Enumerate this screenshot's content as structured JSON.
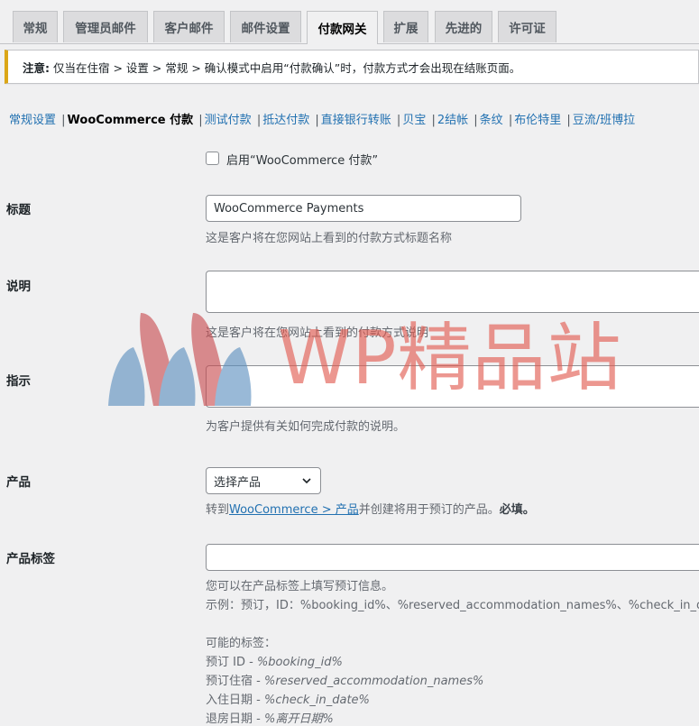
{
  "tabs": [
    {
      "label": "常规",
      "active": false
    },
    {
      "label": "管理员邮件",
      "active": false
    },
    {
      "label": "客户邮件",
      "active": false
    },
    {
      "label": "邮件设置",
      "active": false
    },
    {
      "label": "付款网关",
      "active": true
    },
    {
      "label": "扩展",
      "active": false
    },
    {
      "label": "先进的",
      "active": false
    },
    {
      "label": "许可证",
      "active": false
    }
  ],
  "notice": {
    "strong": "注意:",
    "text": "仅当在住宿 > 设置 > 常规 > 确认模式中启用“付款确认”时，付款方式才会出现在结账页面。"
  },
  "subnav": {
    "items": [
      "常规设置",
      "WooCommerce 付款",
      "测试付款",
      "抵达付款",
      "直接银行转账",
      "贝宝",
      "2结帐",
      "条纹",
      "布伦特里",
      "豆流/班博拉"
    ],
    "current_index": 1
  },
  "enable": {
    "label": "启用“WooCommerce 付款”",
    "checked": false
  },
  "title_field": {
    "label": "标题",
    "value": "WooCommerce Payments",
    "desc": "这是客户将在您网站上看到的付款方式标题名称"
  },
  "description_field": {
    "label": "说明",
    "value": "",
    "desc": "这是客户将在您网站上看到的付款方式说明"
  },
  "instructions_field": {
    "label": "指示",
    "value": "",
    "desc": "为客户提供有关如何完成付款的说明。"
  },
  "product_field": {
    "label": "产品",
    "selected": "选择产品",
    "desc_prefix": "转到",
    "desc_link": "WooCommerce > 产品",
    "desc_suffix": "并创建将用于预订的产品。",
    "desc_required": "必填。"
  },
  "product_label_field": {
    "label": "产品标签",
    "value": "",
    "desc1": "您可以在产品标签上填写预订信息。",
    "desc2": "示例：预订，ID：%booking_id%、%reserved_accommodation_names%、%check_in_date",
    "tags_heading": "可能的标签：",
    "tags": [
      {
        "name": "预订 ID - ",
        "code": "%booking_id%"
      },
      {
        "name": "预订住宿 - ",
        "code": "%reserved_accommodation_names%"
      },
      {
        "name": "入住日期 - ",
        "code": "%check_in_date%"
      },
      {
        "name": "退房日期 - ",
        "code": "%离开日期%"
      }
    ]
  },
  "watermark": {
    "text": "WP精品站"
  },
  "colors": {
    "link": "#2271b1",
    "notice_border": "#dba617",
    "watermark_red": "#e2584d",
    "watermark_blue": "#5b8fbf"
  }
}
